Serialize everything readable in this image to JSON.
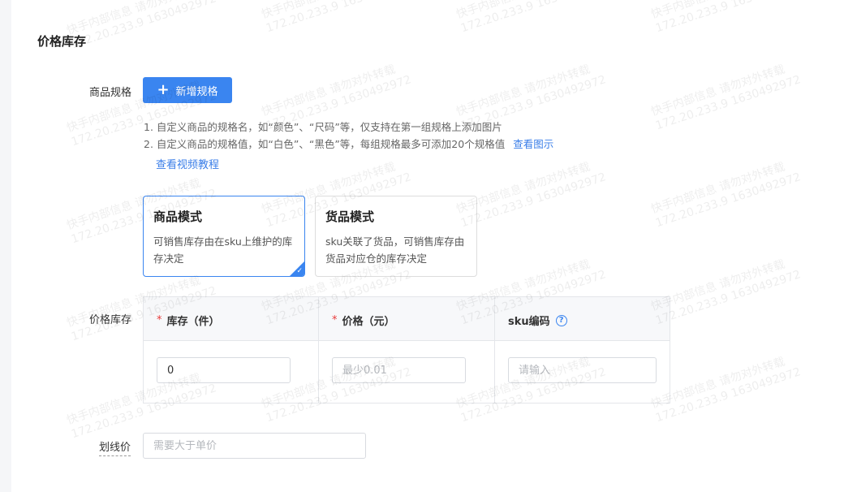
{
  "section": {
    "title": "价格库存"
  },
  "spec": {
    "label": "商品规格",
    "add_button": {
      "icon": "plus-icon",
      "label": "新增规格"
    },
    "tips": [
      "1. 自定义商品的规格名，如“颜色”、“尺码”等，仅支持在第一组规格上添加图片",
      "2. 自定义商品的规格值，如“白色”、“黑色”等，每组规格最多可添加20个规格值"
    ],
    "view_example_link": "查看图示",
    "video_tutorial_link": "查看视频教程"
  },
  "modes": [
    {
      "title": "商品模式",
      "desc": "可销售库存由在sku上维护的库存决定",
      "selected": true
    },
    {
      "title": "货品模式",
      "desc": "sku关联了货品，可销售库存由货品对应仓的库存决定",
      "selected": false
    }
  ],
  "price_stock": {
    "label": "价格库存",
    "required_mark": "*",
    "columns": [
      {
        "title": "库存（件）",
        "required": true
      },
      {
        "title": "价格（元）",
        "required": true
      },
      {
        "title": "sku编码",
        "required": false,
        "help_icon": "question-circle-icon",
        "help_glyph": "?"
      }
    ],
    "row": {
      "stock_value": "0",
      "price_placeholder": "最少0.01",
      "sku_placeholder": "请输入"
    }
  },
  "strike_price": {
    "label": "划线价",
    "placeholder": "需要大于单价"
  },
  "watermark": {
    "line1": "快手内部信息 请勿对外转载",
    "line2": "172.20.233.9 1630492972"
  },
  "colors": {
    "accent": "#3a85f0",
    "required": "#e83a3a",
    "link": "#3a7ee8"
  }
}
